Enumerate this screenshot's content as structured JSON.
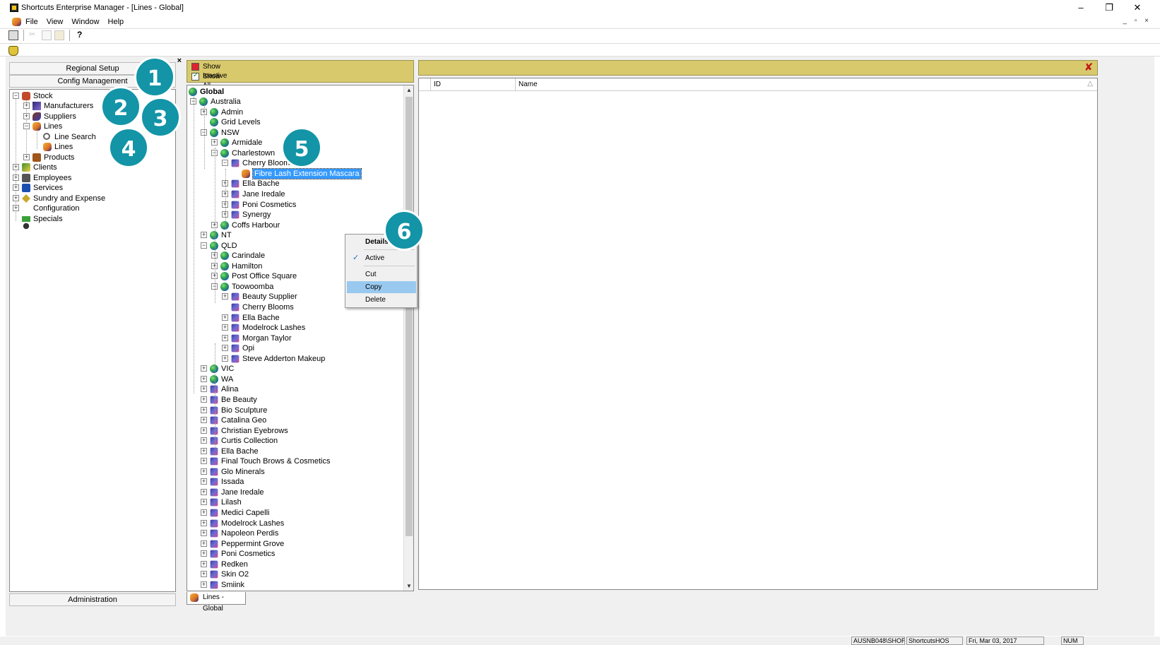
{
  "window": {
    "title": "Shortcuts Enterprise Manager - [Lines - Global]",
    "buttons": [
      "–",
      "❐",
      "✕"
    ],
    "mdi_buttons": "_ ▫ ×"
  },
  "menu": {
    "items": [
      "File",
      "View",
      "Window",
      "Help"
    ]
  },
  "left_panel": {
    "close": "×",
    "regional_setup": "Regional Setup",
    "config_management": "Config Management",
    "administration": "Administration",
    "tree": [
      "Stock",
      "Manufacturers",
      "Suppliers",
      "Lines",
      "Line Search",
      "Lines",
      "Products",
      "Clients",
      "Employees",
      "Services",
      "Sundry and Expense",
      "Configuration",
      "Specials"
    ]
  },
  "filters": {
    "show_inactive": "Show Inactive",
    "show_all_regions": "Show All Regions"
  },
  "region_tree": {
    "root": "Global",
    "items": [
      "Australia",
      "Admin",
      "Grid Levels",
      "NSW",
      "Armidale",
      "Charlestown",
      "Cherry Blooms",
      "Fibre Lash Extension Mascara",
      "Ella Bache",
      "Jane Iredale",
      "Poni Cosmetics",
      "Synergy",
      "Coffs Harbour",
      "NT",
      "QLD",
      "Carindale",
      "Hamilton",
      "Post Office Square",
      "Toowoomba",
      "Beauty Supplier",
      "Cherry Blooms",
      "Ella Bache",
      "Modelrock Lashes",
      "Morgan Taylor",
      "Opi",
      "Steve Adderton Makeup",
      "VIC",
      "WA",
      "Alina",
      "Be Beauty",
      "Bio Sculpture",
      "Catalina Geo",
      "Christian Eyebrows",
      "Curtis Collection",
      "Ella Bache",
      "Final Touch Brows & Cosmetics",
      "Glo Minerals",
      "Issada",
      "Jane Iredale",
      "Lilash",
      "Medici Capelli",
      "Modelrock Lashes",
      "Napoleon Perdis",
      "Peppermint Grove",
      "Poni Cosmetics",
      "Redken",
      "Skin O2",
      "Smiink"
    ]
  },
  "context_menu": {
    "details": "Details",
    "active": "Active",
    "cut": "Cut",
    "copy": "Copy",
    "delete": "Delete"
  },
  "grid": {
    "columns": [
      "ID",
      "Name"
    ]
  },
  "tab": "Lines - Global",
  "badges": [
    "1",
    "2",
    "3",
    "4",
    "5",
    "6"
  ],
  "status": {
    "user": "AUSNB048\\SHOR",
    "db": "ShortcutsHOS",
    "date": "Fri, Mar 03, 2017",
    "num": "NUM"
  },
  "colors": {
    "accent_bar": "#d8c96c",
    "badge": "#1394a7",
    "highlight": "#99c9ef",
    "selection": "#3399ff"
  }
}
